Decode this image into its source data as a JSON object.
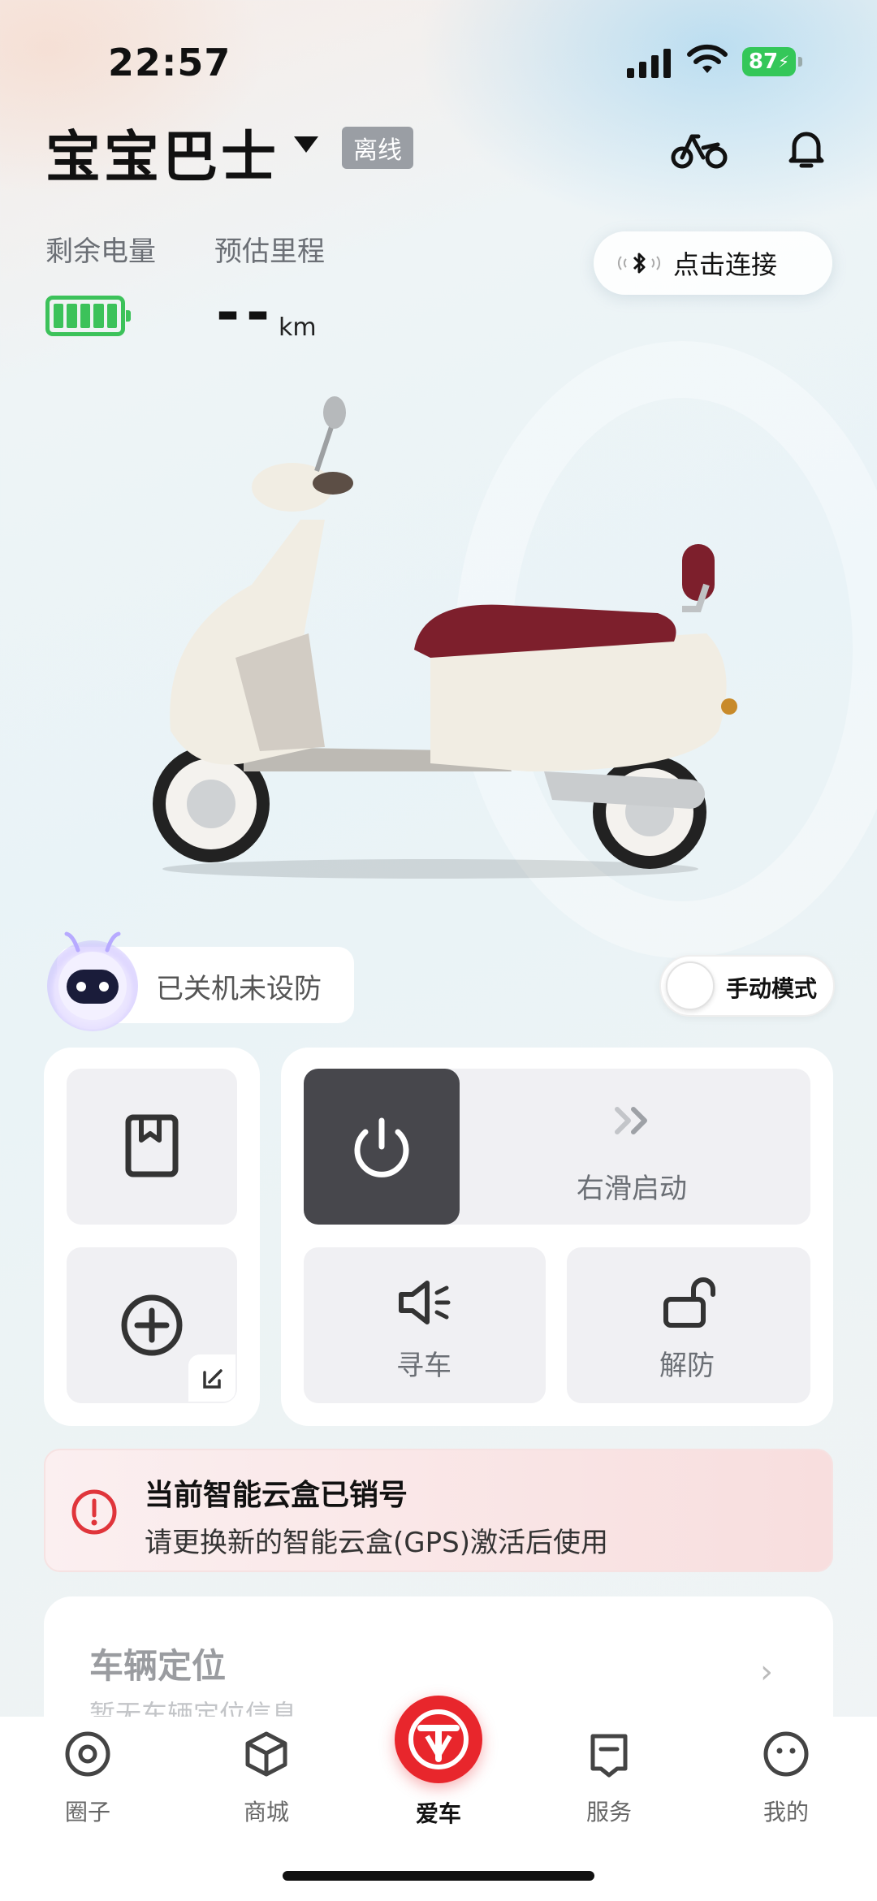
{
  "status_bar": {
    "time": "22:57",
    "battery": "87"
  },
  "header": {
    "vehicle_name": "宝宝巴士",
    "status_tag": "离线"
  },
  "stats": {
    "battery_label": "剩余电量",
    "range_label": "预估里程",
    "range_value": "--",
    "range_unit": "km"
  },
  "connect_button": {
    "label": "点击连接"
  },
  "vehicle_state": {
    "text": "已关机未设防"
  },
  "mode_toggle": {
    "label": "手动模式",
    "on": false
  },
  "controls": {
    "slide_label": "右滑启动",
    "find_label": "寻车",
    "unlock_label": "解防"
  },
  "alert": {
    "title": "当前智能云盒已销号",
    "message": "请更换新的智能云盒(GPS)激活后使用"
  },
  "location": {
    "title": "车辆定位",
    "subtitle": "暂无车辆定位信息"
  },
  "tabs": [
    {
      "label": "圈子",
      "icon": "circle-icon"
    },
    {
      "label": "商城",
      "icon": "cube-icon"
    },
    {
      "label": "爱车",
      "icon": "brand-logo-icon",
      "active": true
    },
    {
      "label": "服务",
      "icon": "message-icon"
    },
    {
      "label": "我的",
      "icon": "smiley-icon"
    }
  ],
  "colors": {
    "accent_red": "#e8262c",
    "battery_green": "#3cc25a",
    "offline_gray": "#9a9ea4",
    "power_button": "#47474c"
  }
}
